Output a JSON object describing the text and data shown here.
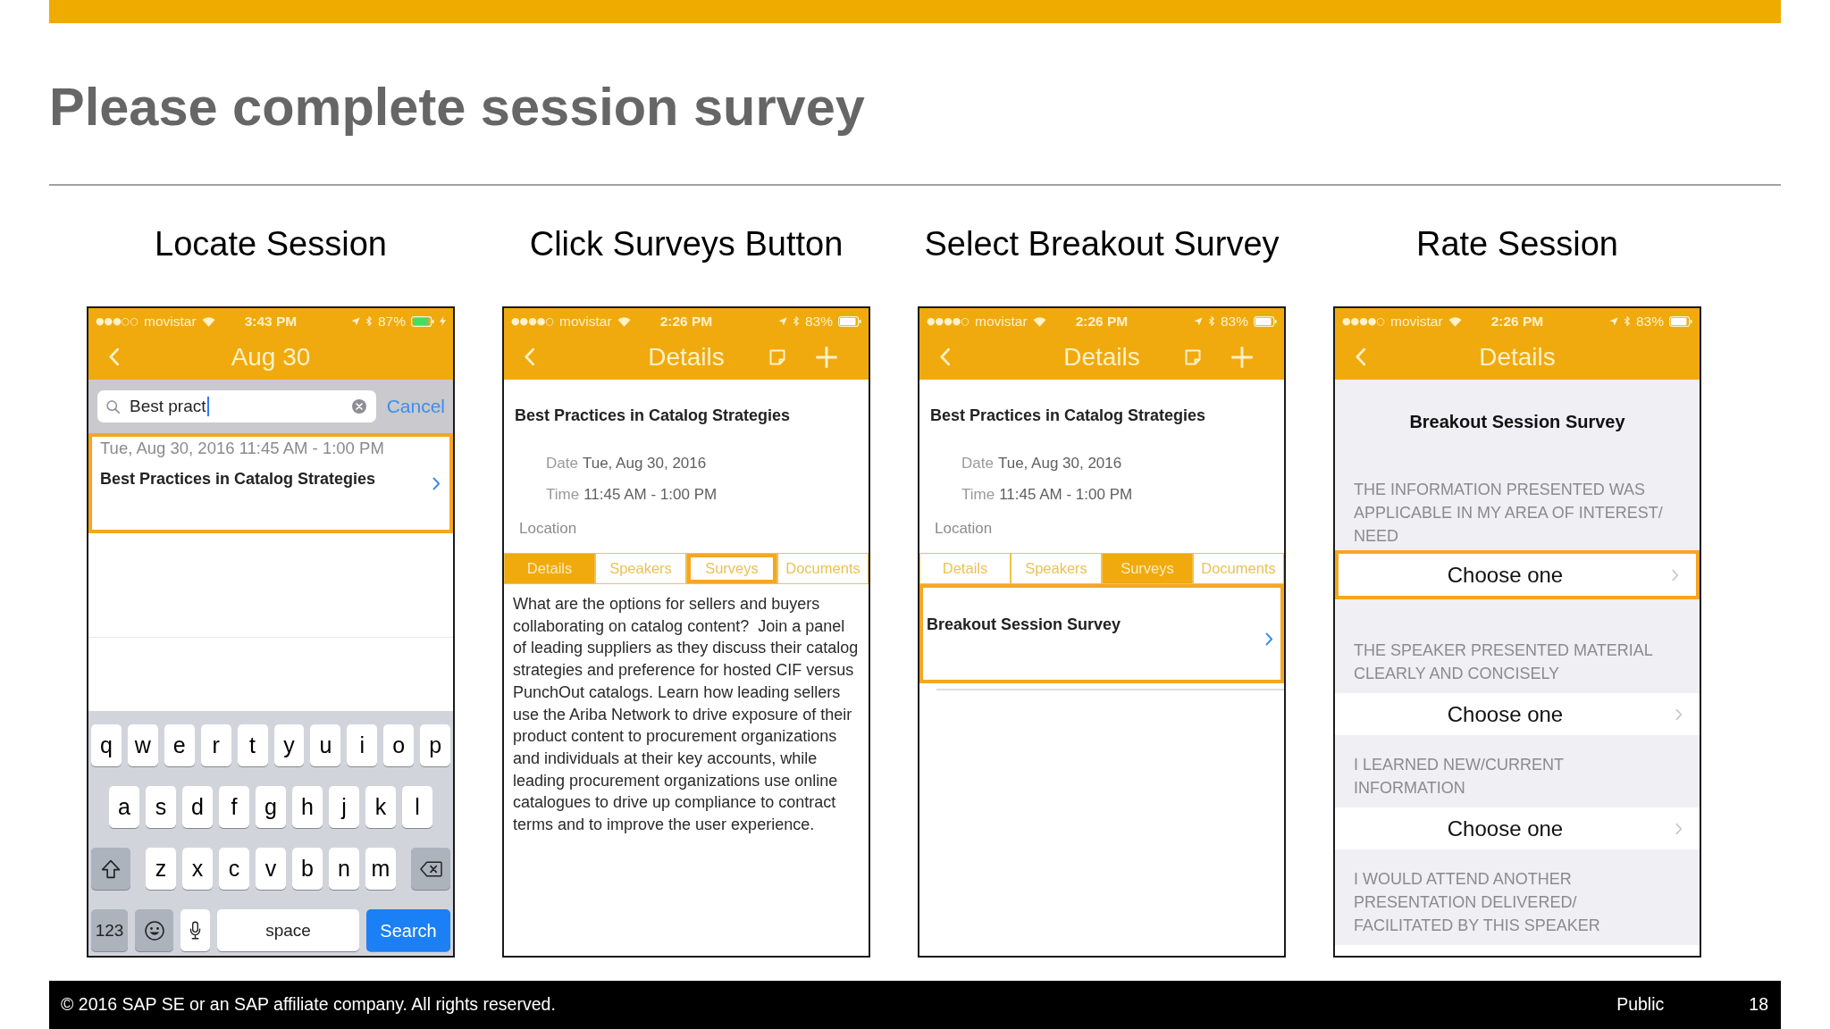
{
  "slide": {
    "title": "Please complete session survey"
  },
  "steps": [
    {
      "kind": "search",
      "heading": "Locate Session",
      "status_bar": {
        "signal": "●●●○○",
        "carrier": "movistar",
        "time": "3:43 PM",
        "battery": "87%",
        "charging": true
      },
      "nav_title": "Aug 30",
      "search": {
        "value": "Best pract",
        "cancel": "Cancel"
      },
      "results": [
        {
          "datetime": "Tue, Aug 30, 2016 11:45 AM - 1:00 PM",
          "title": "Best Practices in Catalog Strategies",
          "highlighted": true
        }
      ],
      "keyboard": {
        "rows": [
          [
            "q",
            "w",
            "e",
            "r",
            "t",
            "y",
            "u",
            "i",
            "o",
            "p"
          ],
          [
            "a",
            "s",
            "d",
            "f",
            "g",
            "h",
            "j",
            "k",
            "l"
          ],
          [
            "z",
            "x",
            "c",
            "v",
            "b",
            "n",
            "m"
          ]
        ],
        "numbers_key": "123",
        "space_key": "space",
        "return_key": "Search"
      }
    },
    {
      "kind": "details",
      "heading": "Click Surveys Button",
      "status_bar": {
        "signal": "●●●●○",
        "carrier": "movistar",
        "time": "2:26 PM",
        "battery": "83%",
        "charging": false
      },
      "nav_title": "Details",
      "session": {
        "title": "Best Practices in Catalog Strategies",
        "fields": [
          {
            "label": "Date",
            "value": "Tue, Aug 30, 2016"
          },
          {
            "label": "Time",
            "value": "11:45 AM - 1:00 PM"
          }
        ],
        "location_label": "Location"
      },
      "tabs": [
        {
          "label": "Details",
          "selected": true,
          "highlighted": false
        },
        {
          "label": "Speakers",
          "selected": false,
          "highlighted": false
        },
        {
          "label": "Surveys",
          "selected": false,
          "highlighted": true
        },
        {
          "label": "Documents",
          "selected": false,
          "highlighted": false
        }
      ],
      "description": "What are the options for sellers and buyers collaborating on catalog content?  Join a panel of leading suppliers as they discuss their catalog strategies and preference for hosted CIF versus PunchOut catalogs. Learn how leading sellers use the Ariba Network to drive exposure of their product content to procurement organizations and individuals at their key accounts, while leading procurement organizations use online catalogues to drive up compliance to contract terms and to improve the user experience."
    },
    {
      "kind": "details",
      "heading": "Select Breakout Survey",
      "status_bar": {
        "signal": "●●●●○",
        "carrier": "movistar",
        "time": "2:26 PM",
        "battery": "83%",
        "charging": false
      },
      "nav_title": "Details",
      "session": {
        "title": "Best Practices in Catalog Strategies",
        "fields": [
          {
            "label": "Date",
            "value": "Tue, Aug 30, 2016"
          },
          {
            "label": "Time",
            "value": "11:45 AM - 1:00 PM"
          }
        ],
        "location_label": "Location"
      },
      "tabs": [
        {
          "label": "Details",
          "selected": false,
          "highlighted": false
        },
        {
          "label": "Speakers",
          "selected": false,
          "highlighted": false
        },
        {
          "label": "Surveys",
          "selected": true,
          "highlighted": false
        },
        {
          "label": "Documents",
          "selected": false,
          "highlighted": false
        }
      ],
      "surveys": [
        {
          "title": "Breakout Session Survey",
          "highlighted": true
        }
      ]
    },
    {
      "kind": "survey",
      "heading": "Rate Session",
      "status_bar": {
        "signal": "●●●●○",
        "carrier": "movistar",
        "time": "2:26 PM",
        "battery": "83%",
        "charging": false
      },
      "nav_title": "Details",
      "survey": {
        "title": "Breakout Session Survey",
        "questions": [
          {
            "text": "THE INFORMATION PRESENTED WAS APPLICABLE IN MY AREA OF INTEREST/NEED",
            "answer": "Choose one",
            "highlighted": true
          },
          {
            "text": "THE SPEAKER PRESENTED MATERIAL CLEARLY AND CONCISELY",
            "answer": "Choose one",
            "highlighted": false
          },
          {
            "text": "I LEARNED NEW/CURRENT INFORMATION",
            "answer": "Choose one",
            "highlighted": false
          },
          {
            "text": "I WOULD ATTEND ANOTHER PRESENTATION DELIVERED/FACILITATED BY THIS SPEAKER",
            "highlighted": false
          }
        ]
      }
    }
  ],
  "footer": {
    "copyright": "© 2016 SAP SE or an SAP affiliate company. All rights reserved.",
    "classification": "Public",
    "page_number": "18"
  }
}
